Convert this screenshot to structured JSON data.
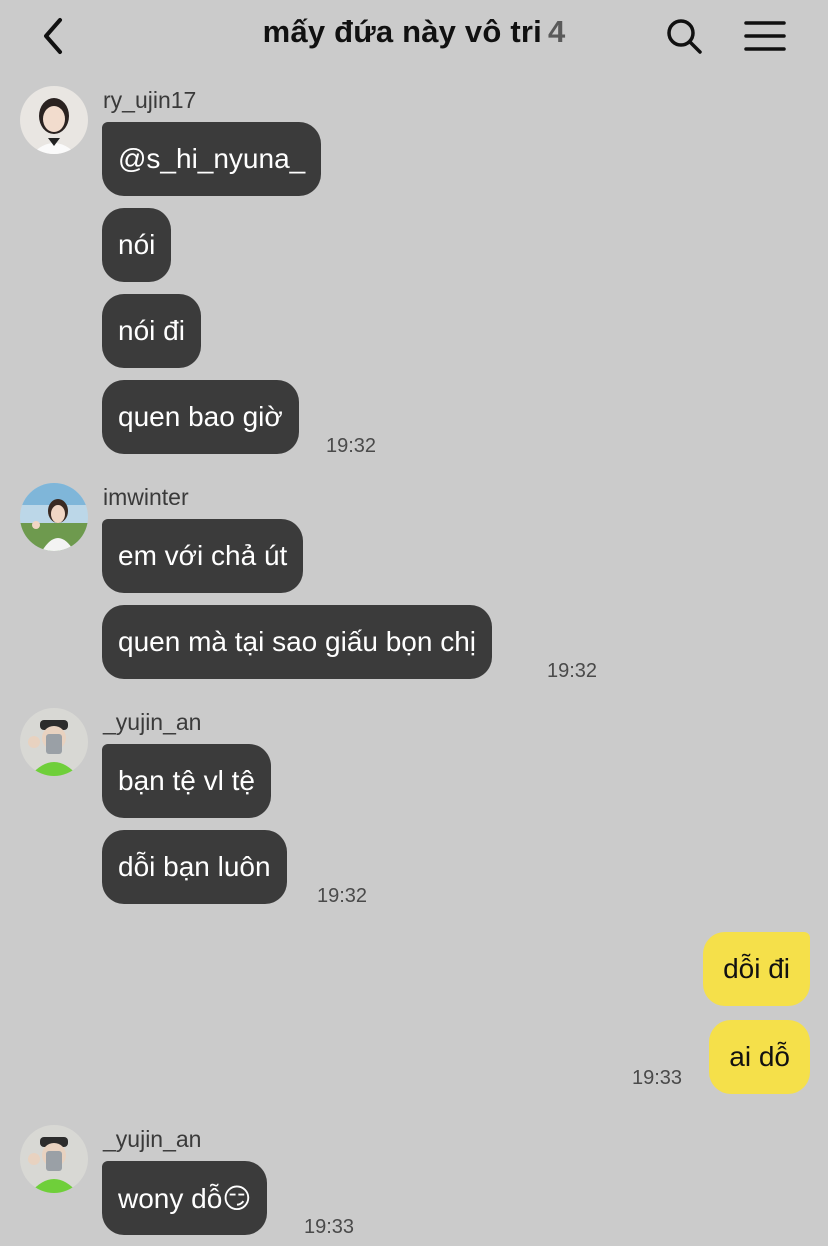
{
  "header": {
    "title": "mấy đứa này vô tri",
    "member_count": "4",
    "back_icon": "chevron-left-icon",
    "search_icon": "search-icon",
    "menu_icon": "hamburger-menu-icon"
  },
  "colors": {
    "background": "#cbcbcb",
    "incoming_bubble": "#3b3b3b",
    "outgoing_bubble": "#f5e04a"
  },
  "messages": {
    "g1": {
      "username": "ry_ujin17",
      "texts": [
        "@s_hi_nyuna_",
        "nói",
        "nói đi",
        "quen bao giờ"
      ],
      "time": "19:32"
    },
    "g2": {
      "username": "imwinter",
      "texts": [
        "em với chả út",
        "quen mà tại sao giấu bọn chị"
      ],
      "time": "19:32"
    },
    "g3": {
      "username": "_yujin_an",
      "texts": [
        "bạn tệ vl tệ",
        "dỗi bạn luôn"
      ],
      "time": "19:32"
    },
    "mine": {
      "texts": [
        "dỗi đi",
        "ai dỗ"
      ],
      "time": "19:33"
    },
    "g4": {
      "username": "_yujin_an",
      "texts": [
        "wony dỗ😏"
      ],
      "time": "19:33"
    }
  }
}
